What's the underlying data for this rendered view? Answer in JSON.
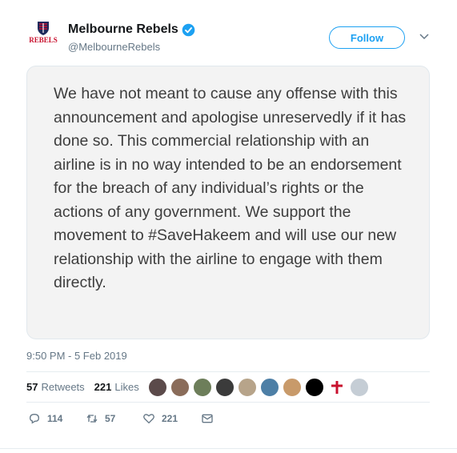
{
  "account": {
    "display_name": "Melbourne Rebels",
    "handle": "@MelbourneRebels",
    "avatar_text": "REBELS"
  },
  "follow_label": "Follow",
  "quote_text": "We have not meant to cause any offense with this announcement and apologise unreservedly if it has done so. This commercial relationship with an airline is in no way intended to be an endorsement for the breach of any individual’s rights or the actions of any government. We support the movement to #SaveHakeem and will use our new relationship with the airline to engage with them directly.",
  "timestamp": "9:50 PM - 5 Feb 2019",
  "stats": {
    "retweets_count": "57",
    "retweets_label": "Retweets",
    "likes_count": "221",
    "likes_label": "Likes"
  },
  "likers": [
    "#5b4a4a",
    "#8a6c5a",
    "#6d7e5a",
    "#3b3b3b",
    "#b7a48a",
    "#4d7fa6",
    "#c89a6a",
    "#000000",
    "#ffffff",
    "#c5cdd5"
  ],
  "actions": {
    "replies": "114",
    "retweets": "57",
    "likes": "221"
  },
  "colors": {
    "accent": "#1da1f2",
    "brand_red": "#c8102e",
    "muted": "#657786"
  }
}
